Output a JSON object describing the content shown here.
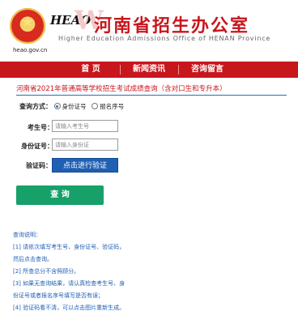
{
  "header": {
    "logo_text": "HEAO",
    "title": "河南省招生办公室",
    "subtitle": "Higher Education Admissions Office of HENAN Province",
    "url": "heao.gov.cn"
  },
  "nav": {
    "items": [
      "首 页",
      "新闻资讯",
      "咨询留言"
    ]
  },
  "query": {
    "title": "河南省2021年普通高等学校招生考试成绩查询（含对口生和专升本）",
    "mode_label": "查询方式：",
    "mode_options": [
      "身份证号",
      "报名序号"
    ],
    "mode_selected": "身份证号",
    "exam_no_label": "考生号：",
    "exam_no_placeholder": "请输入考生号",
    "id_label": "身份证号：",
    "id_placeholder": "请输入身份证",
    "captcha_label": "验证码：",
    "captcha_button": "点击进行验证",
    "submit_button": "查 询"
  },
  "notes": {
    "lines": [
      "查询说明：",
      "[1] 请依次填写考生号、身份证号、验证码，",
      "然后点击查询。",
      "[2] 所查总分不含照顾分。",
      "[3] 如果无查询结果，请认真检查考生号、身",
      "份证号或者报名序号填写是否有误；",
      "[4] 验证码看不清，可以点击图片重新生成。"
    ]
  },
  "colors": {
    "brand_red": "#c8161d",
    "link_blue": "#1f5fb4",
    "submit_green": "#17a06a"
  }
}
